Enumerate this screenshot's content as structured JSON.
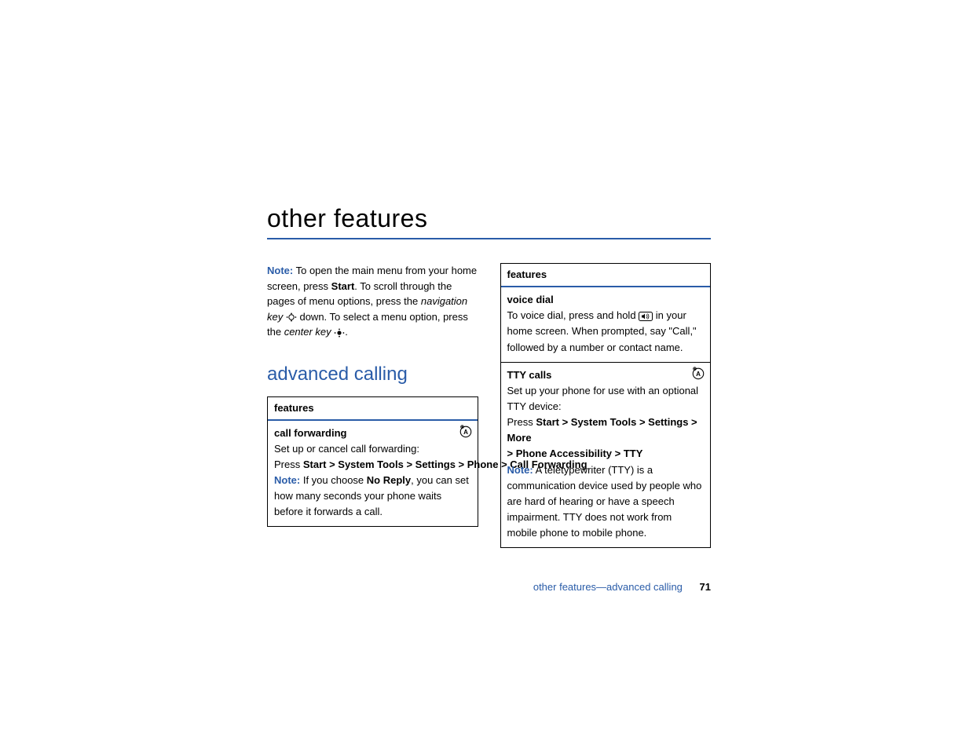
{
  "title": "other features",
  "intro": {
    "noteLabel": "Note:",
    "p1a": " To open the main menu from your home screen, press ",
    "start": "Start",
    "p1b": ". To scroll through the pages of menu options, press the ",
    "navKey": "navigation key",
    "p1c": " down. To select a menu option, press the ",
    "centerKey": "center key",
    "p1d": "."
  },
  "sectionHeading": "advanced calling",
  "leftTable": {
    "header": "features",
    "rowTitle": "call forwarding",
    "desc": "Set up or cancel call forwarding:",
    "pathPrefix": "Press ",
    "path": "Start > System Tools > Settings > Phone > Call Forwarding",
    "note": {
      "label": "Note:",
      "a": " If you choose ",
      "noReply": "No Reply",
      "b": ", you can set how many seconds your phone waits before it forwards a call."
    }
  },
  "rightTable": {
    "header": "features",
    "row1": {
      "title": "voice dial",
      "a": "To voice dial, press and hold ",
      "b": " in your home screen. When prompted, say \"Call,\" followed by a number or contact name."
    },
    "row2": {
      "title": "TTY calls",
      "desc": "Set up your phone for use with an optional TTY device:",
      "pathPrefix": "Press ",
      "path1": "Start > System Tools > Settings > More",
      "path2": "> Phone Accessibility > TTY",
      "note": {
        "label": "Note:",
        "text": " A teletypewriter (TTY) is a communication device used by people who are hard of hearing or have a speech impairment. TTY does not work from mobile phone to mobile phone."
      }
    }
  },
  "footer": {
    "text": "other features—advanced calling",
    "page": "71"
  }
}
